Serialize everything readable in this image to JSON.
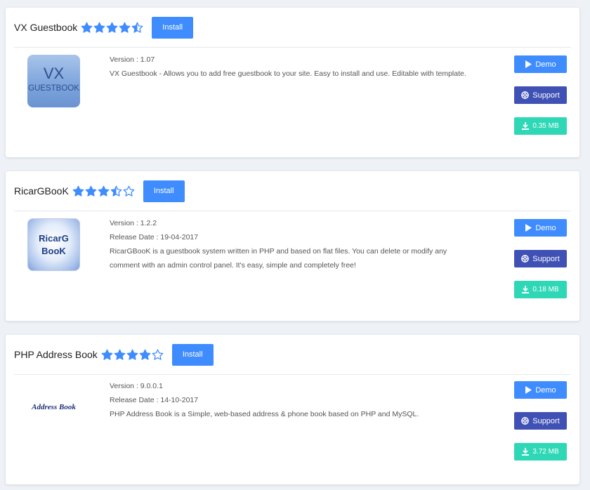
{
  "apps": [
    {
      "title": "VX Guestbook",
      "rating": 4.5,
      "install_label": "Install",
      "logo": {
        "line1": "VX",
        "line2": "GUESTBOOK"
      },
      "version": "Version : 1.07",
      "release_date": "",
      "description": "VX Guestbook - Allows you to add free guestbook to your site. Easy to install and use. Editable with template.",
      "demo_label": "Demo",
      "support_label": "Support",
      "size_label": "0.35 MB"
    },
    {
      "title": "RicarGBooK",
      "rating": 3.5,
      "install_label": "Install",
      "logo": {
        "line1": "RicarG",
        "line2": "BooK"
      },
      "version": "Version : 1.2.2",
      "release_date": "Release Date : 19-04-2017",
      "description": "RicarGBooK is a guestbook system written in PHP and based on flat files. You can delete or modify any comment with an admin control panel. It's easy, simple and completely free!",
      "demo_label": "Demo",
      "support_label": "Support",
      "size_label": "0.18 MB"
    },
    {
      "title": "PHP Address Book",
      "rating": 4,
      "install_label": "Install",
      "logo": {
        "line1": "Address Book",
        "line2": ""
      },
      "version": "Version : 9.0.0.1",
      "release_date": "Release Date : 14-10-2017",
      "description": "PHP Address Book is a Simple, web-based address & phone book based on PHP and MySQL.",
      "demo_label": "Demo",
      "support_label": "Support",
      "size_label": "3.72 MB"
    }
  ],
  "colors": {
    "accent": "#3f8cff",
    "support": "#3f51b5",
    "size": "#2ed8b6",
    "star": "#3f8cff"
  }
}
